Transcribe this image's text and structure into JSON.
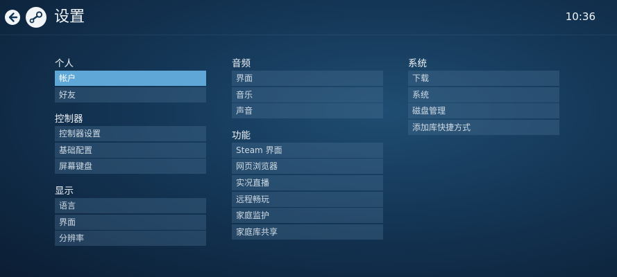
{
  "header": {
    "title": "设置",
    "time": "10:36",
    "back_icon": "back-arrow-icon",
    "logo_icon": "steam-logo-icon"
  },
  "columns": [
    {
      "sections": [
        {
          "title": "个人",
          "items": [
            "帐户",
            "好友"
          ],
          "selected_index": 0
        },
        {
          "title": "控制器",
          "items": [
            "控制器设置",
            "基础配置",
            "屏幕键盘"
          ]
        },
        {
          "title": "显示",
          "items": [
            "语言",
            "界面",
            "分辨率"
          ]
        }
      ]
    },
    {
      "sections": [
        {
          "title": "音频",
          "items": [
            "界面",
            "音乐",
            "声音"
          ]
        },
        {
          "title": "功能",
          "items": [
            "Steam 界面",
            "网页浏览器",
            "实况直播",
            "远程畅玩",
            "家庭监护",
            "家庭库共享"
          ]
        }
      ]
    },
    {
      "sections": [
        {
          "title": "系统",
          "items": [
            "下载",
            "系统",
            "磁盘管理",
            "添加库快捷方式"
          ]
        }
      ]
    }
  ],
  "colors": {
    "selected": "#5fa7d6",
    "item_bg": "#2e5573",
    "background": "#143656"
  }
}
